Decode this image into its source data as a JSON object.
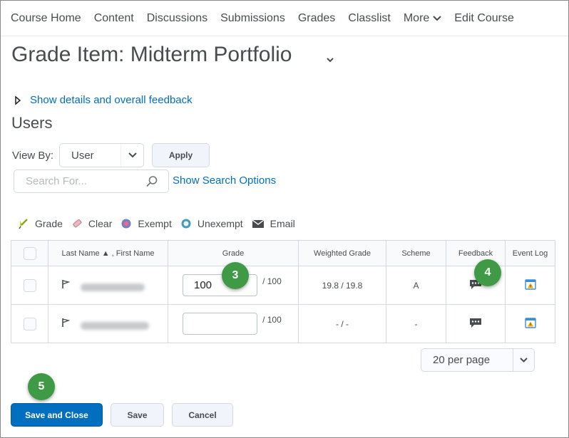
{
  "nav": {
    "items": [
      "Course Home",
      "Content",
      "Discussions",
      "Submissions",
      "Grades",
      "Classlist"
    ],
    "more_label": "More",
    "edit_course": "Edit Course"
  },
  "page": {
    "title": "Grade Item: Midterm Portfolio",
    "show_details": "Show details and overall feedback",
    "users_heading": "Users"
  },
  "filters": {
    "view_by_label": "View By:",
    "view_by_value": "User",
    "apply_label": "Apply",
    "search_placeholder": "Search For...",
    "search_options": "Show Search Options"
  },
  "toolbar": {
    "grade": "Grade",
    "clear": "Clear",
    "exempt": "Exempt",
    "unexempt": "Unexempt",
    "email": "Email"
  },
  "table": {
    "headers": {
      "name": "Last Name ▲ , First Name",
      "grade": "Grade",
      "weighted": "Weighted Grade",
      "scheme": "Scheme",
      "feedback": "Feedback",
      "event_log": "Event Log"
    },
    "rows": [
      {
        "grade_value": "100",
        "grade_out_of": "/ 100",
        "weighted": "19.8 / 19.8",
        "scheme": "A"
      },
      {
        "grade_value": "",
        "grade_out_of": "/ 100",
        "weighted": "- / -",
        "scheme": "-"
      }
    ]
  },
  "pagination": {
    "per_page": "20 per page"
  },
  "actions": {
    "save_close": "Save and Close",
    "save": "Save",
    "cancel": "Cancel"
  },
  "callouts": {
    "grade": "3",
    "feedback": "4",
    "save_close": "5"
  },
  "colors": {
    "link": "#006fbf",
    "primary": "#006fbf",
    "callout": "#3f9a45"
  }
}
